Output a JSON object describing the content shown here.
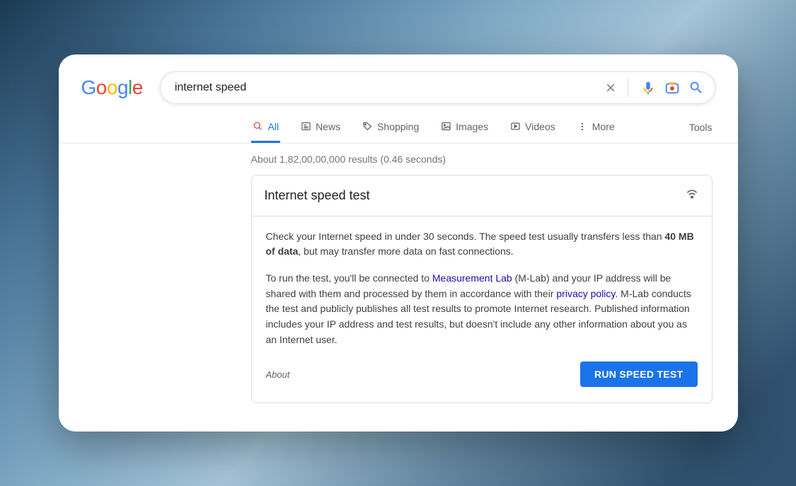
{
  "logo": {
    "parts": [
      {
        "char": "G",
        "color": "#4285F4"
      },
      {
        "char": "o",
        "color": "#EA4335"
      },
      {
        "char": "o",
        "color": "#FBBC05"
      },
      {
        "char": "g",
        "color": "#4285F4"
      },
      {
        "char": "l",
        "color": "#34A853"
      },
      {
        "char": "e",
        "color": "#EA4335"
      }
    ]
  },
  "search": {
    "value": "internet speed"
  },
  "tabs": {
    "all": "All",
    "news": "News",
    "shopping": "Shopping",
    "images": "Images",
    "videos": "Videos",
    "more": "More",
    "tools": "Tools"
  },
  "stats": "About 1,82,00,00,000 results (0.46 seconds)",
  "card": {
    "title": "Internet speed test",
    "p1_a": "Check your Internet speed in under 30 seconds. The speed test usually transfers less than ",
    "p1_b": "40 MB of data",
    "p1_c": ", but may transfer more data on fast connections.",
    "p2_a": "To run the test, you'll be connected to ",
    "p2_link1": "Measurement Lab",
    "p2_b": " (M-Lab) and your IP address will be shared with them and processed by them in accordance with their ",
    "p2_link2": "privacy policy",
    "p2_c": ". M-Lab conducts the test and publicly publishes all test results to promote Internet research. Published information includes your IP address and test results, but doesn't include any other information about you as an Internet user.",
    "about": "About",
    "run": "RUN SPEED TEST"
  }
}
